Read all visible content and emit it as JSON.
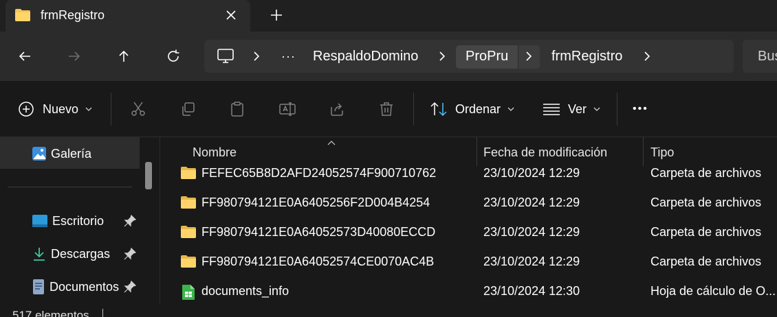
{
  "tab": {
    "title": "frmRegistro",
    "close": "✕",
    "new_tab": "+"
  },
  "address": {
    "ellipsis": "···",
    "segments": [
      "RespaldoDomino",
      "ProPru",
      "frmRegistro"
    ]
  },
  "search": {
    "placeholder": "Bus"
  },
  "toolbar": {
    "new_label": "Nuevo",
    "sort_label": "Ordenar",
    "view_label": "Ver",
    "more": "•••"
  },
  "sidebar": {
    "items": [
      {
        "label": "Galería",
        "icon": "gallery-icon"
      },
      {
        "label": "Escritorio",
        "icon": "desktop-icon",
        "pinned": true
      },
      {
        "label": "Descargas",
        "icon": "downloads-icon",
        "pinned": true
      },
      {
        "label": "Documentos",
        "icon": "documents-icon",
        "pinned": true
      }
    ]
  },
  "columns": [
    "Nombre",
    "Fecha de modificación",
    "Tipo"
  ],
  "files": [
    {
      "name": "FEFEC65B8D2AFD24052574F900710762",
      "date": "23/10/2024 12:29",
      "type": "Carpeta de archivos",
      "icon": "folder-icon"
    },
    {
      "name": "FF980794121E0A6405256F2D004B4254",
      "date": "23/10/2024 12:29",
      "type": "Carpeta de archivos",
      "icon": "folder-icon"
    },
    {
      "name": "FF980794121E0A64052573D40080ECCD",
      "date": "23/10/2024 12:29",
      "type": "Carpeta de archivos",
      "icon": "folder-icon"
    },
    {
      "name": "FF980794121E0A64052574CE0070AC4B",
      "date": "23/10/2024 12:29",
      "type": "Carpeta de archivos",
      "icon": "folder-icon"
    },
    {
      "name": "documents_info",
      "date": "23/10/2024 12:30",
      "type": "Hoja de cálculo de O...",
      "icon": "spreadsheet-icon"
    }
  ],
  "status": {
    "count": "517 elementos"
  },
  "colors": {
    "folder": "#f3c65b",
    "accent": "#4cc2ff",
    "background": "#191919"
  }
}
